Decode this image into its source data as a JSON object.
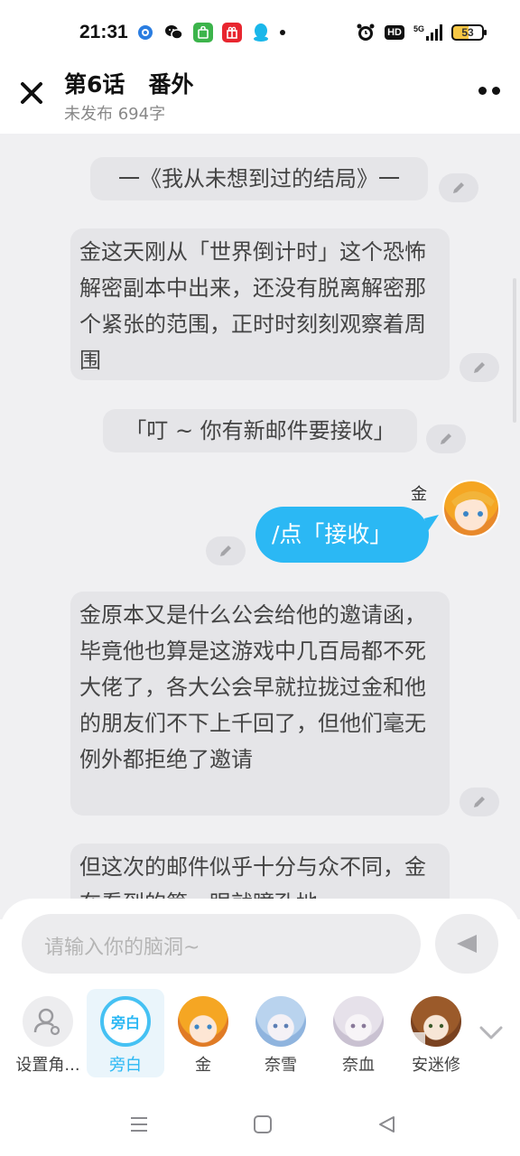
{
  "status": {
    "time": "21:31",
    "hd": "HD",
    "network": "5G",
    "battery": "53"
  },
  "header": {
    "title": "第6话   番外",
    "subtitle": "未发布 694字"
  },
  "messages": [
    {
      "type": "narration",
      "text": "一《我从未想到过的结局》一"
    },
    {
      "type": "narration",
      "text": "金这天刚从「世界倒计时」这个恐怖解密副本中出来，还没有脱离解密那个紧张的范围，正时时刻刻观察着周围"
    },
    {
      "type": "narration",
      "text": "「叮 ~ 你有新邮件要接收」"
    },
    {
      "type": "character",
      "speaker": "金",
      "text": "/点「接收」"
    },
    {
      "type": "narration",
      "text": "金原本又是什么公会给他的邀请函，毕竟他也算是这游戏中几百局都不死大佬了，各大公会早就拉拢过金和他的朋友们不下上千回了，但他们毫无例外都拒绝了邀请"
    },
    {
      "type": "narration",
      "text": "但这次的邮件似乎十分与众不同，金在看到的第一眼就瞳孔地"
    }
  ],
  "input": {
    "placeholder": "请输入你的脑洞~"
  },
  "characters": [
    {
      "label": "设置角...",
      "icon": "person-settings-icon"
    },
    {
      "label": "旁白",
      "inner": "旁白",
      "selected": true
    },
    {
      "label": "金"
    },
    {
      "label": "奈雪"
    },
    {
      "label": "奈血"
    },
    {
      "label": "安迷修"
    }
  ],
  "colors": {
    "accent": "#2bb8f4",
    "bubble": "#e5e5e8",
    "chat_bg": "#f0f0f2"
  }
}
